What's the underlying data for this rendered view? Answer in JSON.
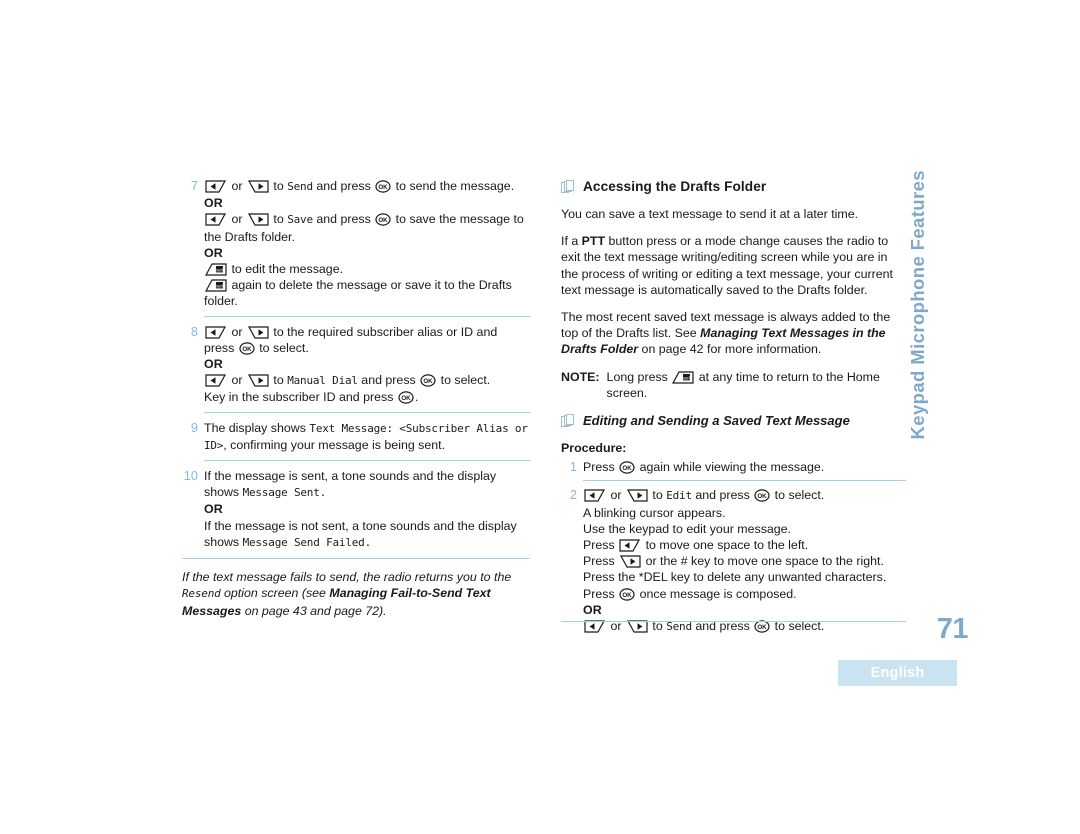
{
  "page": {
    "number": "71",
    "language_band": "English",
    "side_tab": "Keypad Microphone Features"
  },
  "left_column": {
    "steps": [
      {
        "num": "7",
        "lines": [
          {
            "type": "keys_lr",
            "before": "",
            "mid": "to",
            "code": "Send",
            "after": "and press",
            "icon_end": "ok",
            "tail": "to send the message."
          },
          {
            "type": "or"
          },
          {
            "type": "keys_lr",
            "before": "",
            "mid": "to",
            "code": "Save",
            "after": "and press",
            "icon_end": "ok",
            "tail": "to save the message to the Drafts folder."
          },
          {
            "type": "or"
          },
          {
            "type": "back",
            "tail": "to edit the message."
          },
          {
            "type": "back",
            "tail": "again to delete the message or save it to the Drafts folder."
          }
        ]
      },
      {
        "num": "8",
        "lines": [
          {
            "type": "keys_lr_plain",
            "mid": "to the required subscriber alias or ID and press",
            "icon_end": "ok",
            "tail": "to select."
          },
          {
            "type": "or"
          },
          {
            "type": "keys_lr",
            "before": "",
            "mid": "to",
            "code": "Manual Dial",
            "after": "and press",
            "icon_end": "ok",
            "tail": "to select."
          },
          {
            "type": "keyin",
            "text_before": "Key in the subscriber ID and press",
            "icon_end": "ok",
            "tail": "."
          }
        ]
      },
      {
        "num": "9",
        "lines": [
          {
            "type": "display",
            "before": "The display shows",
            "code": "Text Message: <Subscriber Alias or ID>",
            "after": ", confirming your message is being sent."
          }
        ]
      },
      {
        "num": "10",
        "lines": [
          {
            "type": "display",
            "before": "If the message is sent, a tone sounds and the display shows",
            "code": "Message Sent.",
            "after": ""
          },
          {
            "type": "or"
          },
          {
            "type": "display",
            "before": "If the message is not sent, a tone sounds and the display shows",
            "code": "Message Send Failed.",
            "after": ""
          }
        ]
      }
    ],
    "trailing_note": {
      "seg1": "If the text message fails to send, the radio returns you to the ",
      "code": "Resend",
      "seg2": " option screen (see ",
      "bold": "Managing Fail-to-Send Text Messages",
      "seg3": " on page 43 and page 72)."
    }
  },
  "right_column": {
    "heading": "Accessing the Drafts Folder",
    "paragraphs": [
      "You can save a text message to send it at a later time."
    ],
    "para_ptt": {
      "seg1": "If a ",
      "bold": "PTT",
      "seg2": " button press or a mode change causes the radio to exit the text message writing/editing screen while you are in the process of writing or editing a text message, your current text message is automatically saved to the Drafts folder."
    },
    "para_recent": {
      "seg1": "The most recent saved text message is always added to the top of the Drafts list. See ",
      "bold": "Managing Text Messages in the Drafts Folder",
      "seg2": " on page 42 for more information."
    },
    "note": {
      "label": "NOTE:",
      "seg1": "Long press ",
      "seg2": " at any time to return to the Home screen."
    },
    "subheading": "Editing and Sending a Saved Text Message",
    "procedure_label": "Procedure:",
    "steps": [
      {
        "num": "1",
        "lines": [
          {
            "type": "press_ok",
            "before": "Press",
            "after": "again while viewing the message."
          }
        ]
      },
      {
        "num": "2",
        "lines": [
          {
            "type": "keys_lr",
            "before": "",
            "mid": "to",
            "code": "Edit",
            "after": "and press",
            "icon_end": "ok",
            "tail": "to select."
          },
          {
            "type": "plain",
            "text": "A blinking cursor appears."
          },
          {
            "type": "plain",
            "text": "Use the keypad to edit your message."
          },
          {
            "type": "press_left",
            "before": "Press",
            "after": "to move one space to the left."
          },
          {
            "type": "press_right",
            "before": "Press",
            "after": "or the # key to move one space to the right."
          },
          {
            "type": "plain",
            "text": "Press the *DEL key to delete any unwanted characters."
          },
          {
            "type": "press_ok",
            "before": "Press",
            "after": "once message is composed."
          },
          {
            "type": "or"
          },
          {
            "type": "keys_lr",
            "before": "",
            "mid": "to",
            "code": "Send",
            "after": "and press",
            "icon_end": "ok",
            "tail": "to select."
          }
        ]
      }
    ]
  },
  "icons": {
    "left_key": "left-arrow-key-icon",
    "right_key": "right-arrow-key-icon",
    "ok_key": "ok-key-icon",
    "back_key": "back-key-icon",
    "pages": "stacked-pages-icon"
  },
  "colors": {
    "accent_blue": "#7fa9cb",
    "rule_blue": "#a8cee2",
    "step_number": "#8bb8d6",
    "band": "#c9e3f0"
  },
  "literals": {
    "or": "OR",
    "word_or": "or",
    "word_to": "to",
    "word_and_press": "and press"
  }
}
